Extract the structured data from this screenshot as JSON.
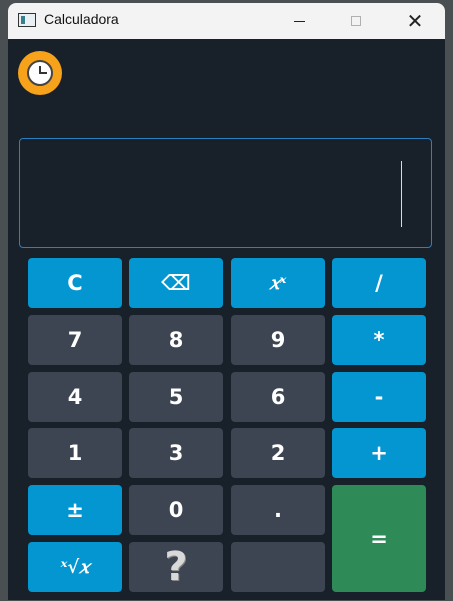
{
  "window": {
    "title": "Calculadora",
    "close_glyph": "✕"
  },
  "display": {
    "value": ""
  },
  "buttons": {
    "clear": "C",
    "backspace": "⌫",
    "power": "𝑥ˣ",
    "divide": "/",
    "seven": "7",
    "eight": "8",
    "nine": "9",
    "multiply": "*",
    "four": "4",
    "five": "5",
    "six": "6",
    "minus": "-",
    "one": "1",
    "three": "3",
    "two": "2",
    "plus": "+",
    "negate": "±",
    "zero": "0",
    "decimal": ".",
    "equals": "=",
    "root": "ˣ√𝑥",
    "help": "?",
    "empty": ""
  },
  "colors": {
    "operator": "#0396d0",
    "digit": "#3e4552",
    "equals": "#2e8b57",
    "history": "#f6a21b",
    "background": "#18202a"
  }
}
